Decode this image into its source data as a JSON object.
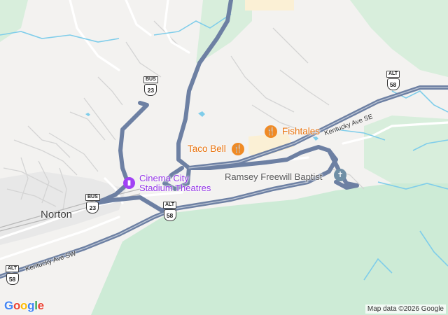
{
  "map": {
    "town_label": "Norton",
    "pois": [
      {
        "name": "Fishtales",
        "category": "restaurant",
        "icon": "fork-knife-icon",
        "color": "#e8710a"
      },
      {
        "name": "Taco Bell",
        "category": "restaurant",
        "icon": "fork-knife-icon",
        "color": "#e8710a"
      },
      {
        "name_line1": "Cinema City",
        "name_line2": "Stadium Theatres",
        "category": "cinema",
        "icon": "film-icon",
        "color": "#9334e6"
      },
      {
        "name": "Ramsey Freewill Baptist",
        "category": "church",
        "icon": "cross-icon",
        "color": "#5f7f97"
      }
    ],
    "streets": {
      "kentucky_ave_se": "Kentucky Ave SE",
      "kentucky_ave_sw": "Kentucky Ave SW"
    },
    "shields": [
      {
        "tag": "BUS",
        "number": "23"
      },
      {
        "tag": "BUS",
        "number": "23"
      },
      {
        "tag": "ALT",
        "number": "58"
      },
      {
        "tag": "ALT",
        "number": "58"
      },
      {
        "tag": "ALT",
        "number": "58"
      }
    ],
    "colors": {
      "background": "#f3f2f0",
      "forest": "#cdebd6",
      "route": "#7d8fb0",
      "water": "#6bc2e6"
    },
    "logo": "Google",
    "attribution": "Map data ©2026 Google"
  }
}
